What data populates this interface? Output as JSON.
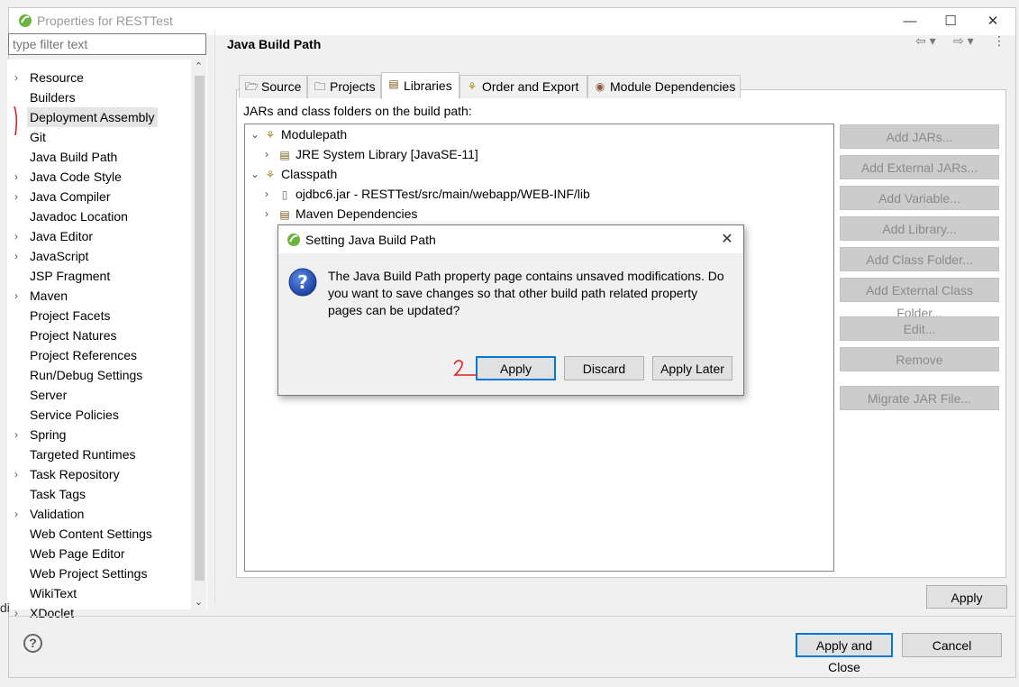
{
  "window": {
    "title": "Properties for RESTTest",
    "minimize": "—",
    "maximize": "☐",
    "close": "✕"
  },
  "filter": {
    "placeholder": "type filter text"
  },
  "tree": {
    "items": [
      {
        "label": "Resource",
        "expandable": true
      },
      {
        "label": "Builders",
        "expandable": false
      },
      {
        "label": "Deployment Assembly",
        "expandable": false,
        "selected": true
      },
      {
        "label": "Git",
        "expandable": false
      },
      {
        "label": "Java Build Path",
        "expandable": false
      },
      {
        "label": "Java Code Style",
        "expandable": true
      },
      {
        "label": "Java Compiler",
        "expandable": true
      },
      {
        "label": "Javadoc Location",
        "expandable": false
      },
      {
        "label": "Java Editor",
        "expandable": true
      },
      {
        "label": "JavaScript",
        "expandable": true
      },
      {
        "label": "JSP Fragment",
        "expandable": false
      },
      {
        "label": "Maven",
        "expandable": true
      },
      {
        "label": "Project Facets",
        "expandable": false
      },
      {
        "label": "Project Natures",
        "expandable": false
      },
      {
        "label": "Project References",
        "expandable": false
      },
      {
        "label": "Run/Debug Settings",
        "expandable": false
      },
      {
        "label": "Server",
        "expandable": false
      },
      {
        "label": "Service Policies",
        "expandable": false
      },
      {
        "label": "Spring",
        "expandable": true
      },
      {
        "label": "Targeted Runtimes",
        "expandable": false
      },
      {
        "label": "Task Repository",
        "expandable": true
      },
      {
        "label": "Task Tags",
        "expandable": false
      },
      {
        "label": "Validation",
        "expandable": true
      },
      {
        "label": "Web Content Settings",
        "expandable": false
      },
      {
        "label": "Web Page Editor",
        "expandable": false
      },
      {
        "label": "Web Project Settings",
        "expandable": false
      },
      {
        "label": "WikiText",
        "expandable": false
      },
      {
        "label": "XDoclet",
        "expandable": true
      }
    ]
  },
  "page": {
    "title": "Java Build Path",
    "tabs": [
      {
        "label": "Source",
        "icon": "source-folder-icon"
      },
      {
        "label": "Projects",
        "icon": "projects-icon"
      },
      {
        "label": "Libraries",
        "icon": "libraries-icon",
        "active": true
      },
      {
        "label": "Order and Export",
        "icon": "order-export-icon"
      },
      {
        "label": "Module Dependencies",
        "icon": "module-icon"
      }
    ],
    "jars_label": "JARs and class folders on the build path:",
    "entries": [
      {
        "label": "Modulepath",
        "level": 0,
        "expanded": true
      },
      {
        "label": "JRE System Library [JavaSE-11]",
        "level": 1,
        "expanded": false
      },
      {
        "label": "Classpath",
        "level": 0,
        "expanded": true
      },
      {
        "label": "ojdbc6.jar - RESTTest/src/main/webapp/WEB-INF/lib",
        "level": 1,
        "expanded": false
      },
      {
        "label": "Maven Dependencies",
        "level": 1,
        "expanded": false
      }
    ],
    "side_buttons": {
      "add_jars": "Add JARs...",
      "add_external_jars": "Add External JARs...",
      "add_variable": "Add Variable...",
      "add_library": "Add Library...",
      "add_class_folder": "Add Class Folder...",
      "add_external_class_folder": "Add External Class Folder...",
      "edit": "Edit...",
      "remove": "Remove",
      "migrate_jar": "Migrate JAR File..."
    },
    "apply": "Apply"
  },
  "footer": {
    "help": "?",
    "apply_and_close": "Apply and Close",
    "cancel": "Cancel"
  },
  "dialog": {
    "title": "Setting Java Build Path",
    "message": "The Java Build Path property page contains unsaved modifications. Do you want to save changes so that other build path related property pages can be updated?",
    "apply": "Apply",
    "discard": "Discard",
    "apply_later": "Apply Later",
    "close": "✕"
  },
  "annotations": {
    "step2": "2"
  },
  "edge": {
    "partial_text": "di"
  },
  "colors": {
    "accent": "#0078d7",
    "annotation": "#e02020",
    "eclipse_green": "#6db33f"
  }
}
